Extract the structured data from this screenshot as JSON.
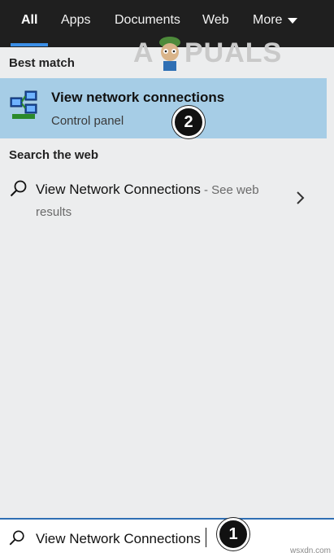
{
  "tabs": [
    {
      "label": "All",
      "active": true
    },
    {
      "label": "Apps"
    },
    {
      "label": "Documents"
    },
    {
      "label": "Web"
    },
    {
      "label": "More"
    }
  ],
  "watermark": {
    "text_left": "A",
    "text_right": "PUALS"
  },
  "best_match": {
    "heading": "Best match",
    "title": "View network connections",
    "subtitle": "Control panel",
    "icon": "network-connections-icon"
  },
  "web_search": {
    "heading": "Search the web",
    "query": "View Network Connections",
    "suffix": " - See web results",
    "icon": "search-icon",
    "arrow_icon": "chevron-right-icon"
  },
  "searchbox": {
    "value": "View Network Connections",
    "icon": "search-icon"
  },
  "annotations": {
    "badge_1": "1",
    "badge_2": "2"
  },
  "credit": "wsxdn.com",
  "colors": {
    "topbar": "#1f1f1f",
    "accent": "#3a8ee6",
    "selected": "#a6cde6",
    "panel": "#ecedee"
  }
}
